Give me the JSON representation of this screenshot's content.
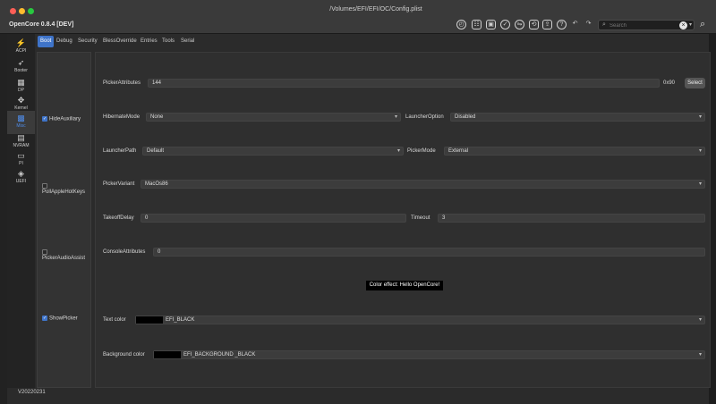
{
  "window": {
    "title": "/Volumes/EFI/EFI/OC/Config.plist",
    "app_title": "OpenCore 0.8.4 [DEV]",
    "status": "V20220231"
  },
  "search": {
    "placeholder": "Search",
    "value": ""
  },
  "tabs": [
    {
      "label": "Boot",
      "active": true
    },
    {
      "label": "Debug"
    },
    {
      "label": "Security"
    },
    {
      "label": "BlessOverride"
    },
    {
      "label": "Entries"
    },
    {
      "label": "Tools"
    },
    {
      "label": "Serial"
    }
  ],
  "sidebar": [
    {
      "label": "ACPI",
      "icon": "lightning-icon"
    },
    {
      "label": "Booter",
      "icon": "rocket-icon"
    },
    {
      "label": "DP",
      "icon": "puzzle-icon"
    },
    {
      "label": "Kernel",
      "icon": "kernel-icon"
    },
    {
      "label": "Misc",
      "icon": "misc-icon",
      "active": true
    },
    {
      "label": "NVRAM",
      "icon": "chip-icon"
    },
    {
      "label": "PI",
      "icon": "monitor-icon"
    },
    {
      "label": "UEFI",
      "icon": "cube-icon"
    }
  ],
  "checkboxes": [
    {
      "label": "HideAuxiliary",
      "checked": true
    },
    {
      "label": "PollAppleHotKeys",
      "checked": false
    },
    {
      "label": "PickerAudioAssist",
      "checked": false
    },
    {
      "label": "ShowPicker",
      "checked": true
    }
  ],
  "fields": {
    "picker_attributes": {
      "label": "PickerAttributes",
      "value": "144",
      "hex": "0x90",
      "button": "Select"
    },
    "hibernate_mode": {
      "label": "HibernateMode",
      "value": "None"
    },
    "launcher_option": {
      "label": "LauncherOption",
      "value": "Disabled"
    },
    "launcher_path": {
      "label": "LauncherPath",
      "value": "Default"
    },
    "picker_mode": {
      "label": "PickerMode",
      "value": "External"
    },
    "picker_variant": {
      "label": "PickerVariant",
      "value": "MacOs86"
    },
    "takeoff_delay": {
      "label": "TakeoffDelay",
      "value": "0"
    },
    "timeout": {
      "label": "Timeout",
      "value": "3"
    },
    "console_attributes": {
      "label": "ConsoleAttributes",
      "value": "0"
    },
    "preview": "Color effect: Hello OpenCore!",
    "text_color": {
      "label": "Text color",
      "value": "EFI_BLACK",
      "swatch": "#000000"
    },
    "background_color": {
      "label": "Background color",
      "value": "EFI_BACKGROUND _BLACK",
      "swatch": "#000000"
    }
  },
  "colors": {
    "accent": "#3f74c9",
    "bg": "#2b2b2b"
  }
}
